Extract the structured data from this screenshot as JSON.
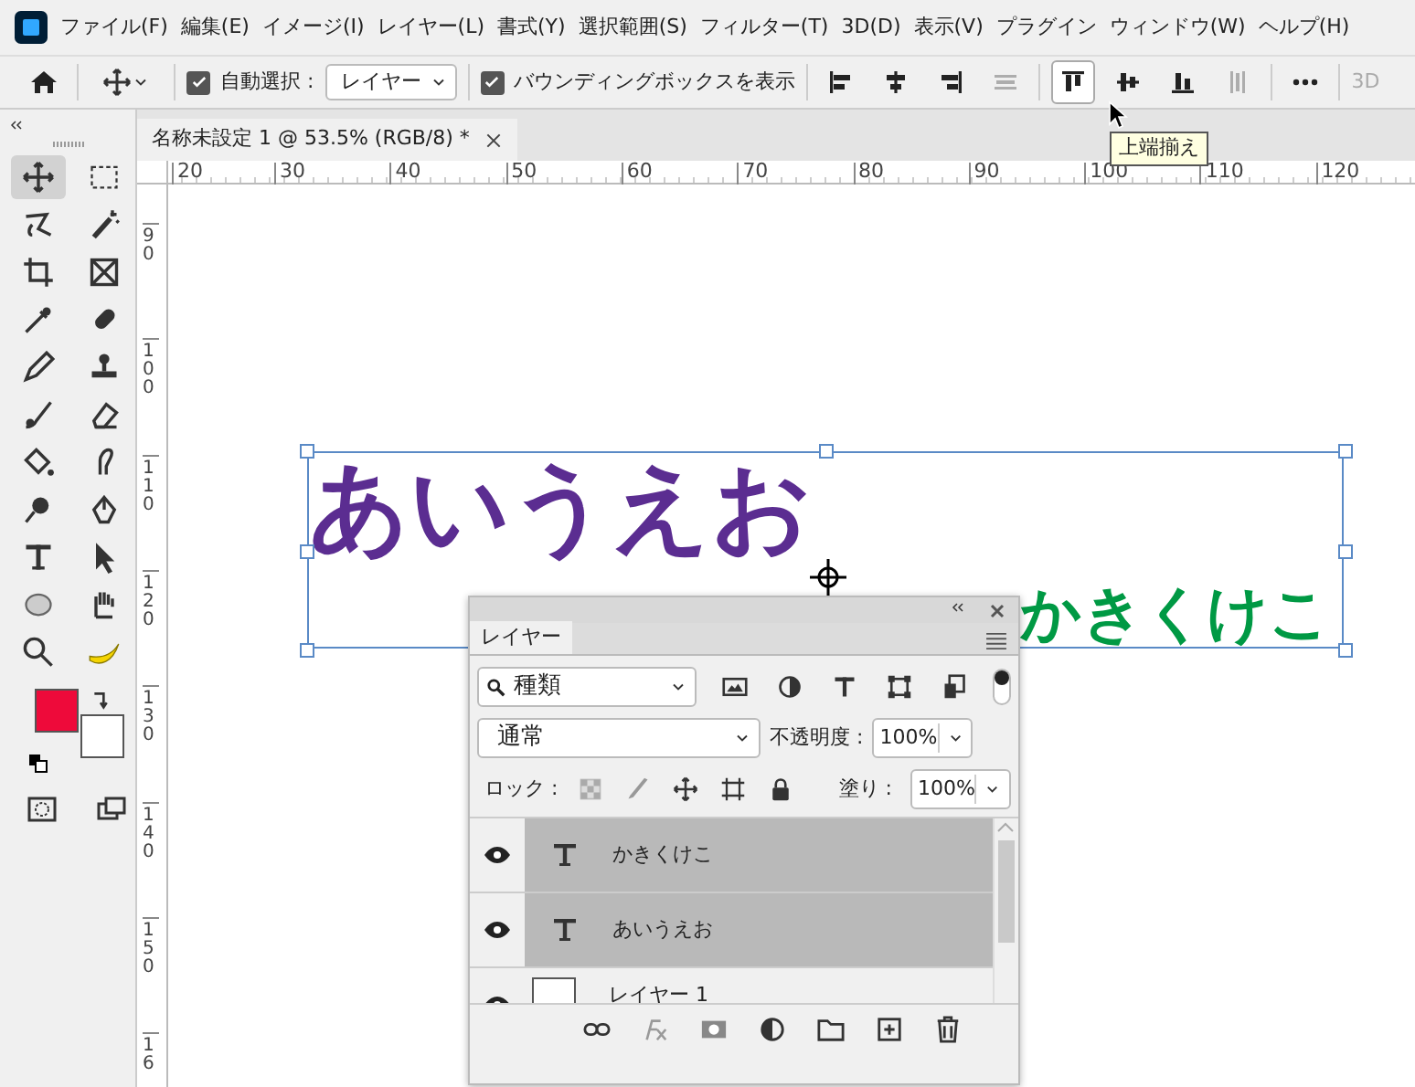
{
  "menu_bar": {
    "items": [
      "ファイル(F)",
      "編集(E)",
      "イメージ(I)",
      "レイヤー(L)",
      "書式(Y)",
      "選択範囲(S)",
      "フィルター(T)",
      "3D(D)",
      "表示(V)",
      "プラグイン",
      "ウィンドウ(W)",
      "ヘルプ(H)"
    ]
  },
  "options_bar": {
    "auto_select": {
      "label": "自動選択 :",
      "checked": true
    },
    "auto_select_target": "レイヤー",
    "show_transform": {
      "label": "バウンディングボックスを表示",
      "checked": true
    },
    "align_buttons": [
      {
        "selected": false,
        "disabled": false
      },
      {
        "selected": false,
        "disabled": false
      },
      {
        "selected": false,
        "disabled": false
      },
      {
        "selected": false,
        "disabled": true
      },
      {
        "selected": true,
        "disabled": false
      },
      {
        "selected": false,
        "disabled": false
      },
      {
        "selected": false,
        "disabled": false
      },
      {
        "selected": false,
        "disabled": true
      }
    ],
    "cut_off_label": "3D"
  },
  "tooltip": "上端揃え",
  "document_tab": {
    "title": "名称未設定 1 @ 53.5% (RGB/8) *"
  },
  "toolbar": {
    "tools": [
      {
        "selected": true
      },
      {
        "selected": false
      },
      {
        "selected": false
      },
      {
        "selected": false
      },
      {
        "selected": false
      },
      {
        "selected": false
      },
      {
        "selected": false
      },
      {
        "selected": false
      },
      {
        "selected": false
      },
      {
        "selected": false
      },
      {
        "selected": false
      },
      {
        "selected": false
      },
      {
        "selected": false
      },
      {
        "selected": false
      },
      {
        "selected": false
      },
      {
        "selected": false
      },
      {
        "selected": false
      },
      {
        "selected": false
      },
      {
        "selected": false
      },
      {
        "selected": false
      },
      {
        "selected": false
      },
      {
        "selected": false
      }
    ],
    "swatches": [
      {
        "color": "#ee0a3a"
      },
      {
        "color": "#ffffff"
      }
    ]
  },
  "rulers": {
    "horizontal": [
      "20",
      "30",
      "40",
      "50",
      "60",
      "70",
      "80",
      "90",
      "100",
      "110",
      "120"
    ],
    "vertical": [
      "90",
      "100",
      "110",
      "120",
      "130",
      "140",
      "150",
      "16"
    ]
  },
  "canvas": {
    "texts": [
      {
        "text": "あいうえお",
        "color": "#5b2d91"
      },
      {
        "text": "かきくけこ",
        "color": "#009944"
      }
    ]
  },
  "layers_panel": {
    "tab": "レイヤー",
    "filter": "種類",
    "blend_mode": "通常",
    "opacity_label": "不透明度 :",
    "opacity": "100%",
    "lock_label": "ロック :",
    "fill_label": "塗り :",
    "fill": "100%",
    "layers": [
      {
        "kind": "text",
        "name": "かきくけこ",
        "visible": true,
        "selected": true
      },
      {
        "kind": "text",
        "name": "あいうえお",
        "visible": true,
        "selected": true
      },
      {
        "kind": "raster",
        "name": "レイヤー 1",
        "visible": true,
        "selected": false
      }
    ]
  }
}
